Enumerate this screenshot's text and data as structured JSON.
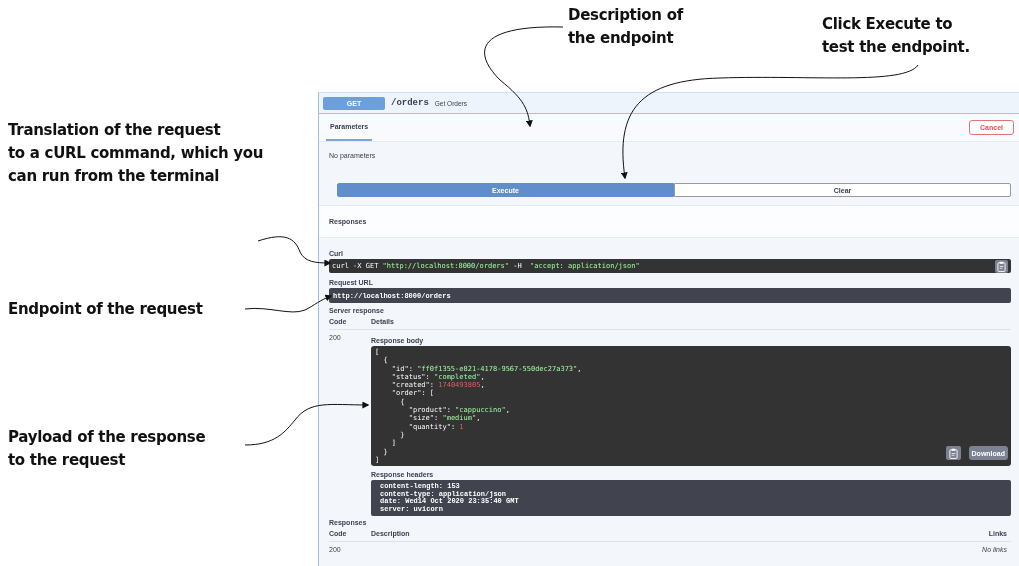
{
  "callouts": [
    {
      "kind": "top-left",
      "text": "Description of\nthe endpoint"
    },
    {
      "kind": "top-right",
      "text": "Click Execute to\ntest the endpoint."
    },
    {
      "kind": "curl",
      "text": "Translation of the request\nto a cURL command, which you\ncan run from the terminal"
    },
    {
      "kind": "url",
      "text": "Endpoint of the request"
    },
    {
      "kind": "payload",
      "text": "Payload of the response\nto the request"
    }
  ],
  "operation": {
    "method": "GET",
    "path": "/orders",
    "summary": "Get Orders"
  },
  "tabs": [
    {
      "label": "Parameters",
      "selected": true
    }
  ],
  "cancel": "Cancel",
  "parameters_note": "No parameters",
  "actions": [
    {
      "label": "Execute",
      "kind": "primary"
    },
    {
      "label": "Clear",
      "kind": "secondary"
    }
  ],
  "responses_title": "Responses",
  "curl": {
    "label": "Curl",
    "command": "curl -X GET \"http://localhost:8000/orders\" -H  \"accept: application/json\""
  },
  "request_url": {
    "label": "Request URL",
    "value": "http://localhost:8000/orders"
  },
  "server_response": {
    "label": "Server response",
    "columns": [
      "Code",
      "Details"
    ],
    "code": "200",
    "body_label": "Response body",
    "body": "[\n  {\n    \"id\": \"ff0f1355-e821-4178-9567-550dec27a373\",\n    \"status\": \"completed\",\n    \"created\": 1740493805,\n    \"order\": [\n      {\n        \"product\": \"cappuccino\",\n        \"size\": \"medium\",\n        \"quantity\": 1\n      }\n    ]\n  }\n]",
    "download": "Download",
    "headers_label": "Response headers",
    "headers": "content-length: 153\ncontent-type: application/json\ndate: Wed14 Oct 2020 23:35:40 GMT\nserver: uvicorn"
  },
  "responses": {
    "label": "Responses",
    "columns": [
      "Code",
      "Description",
      "Links"
    ],
    "rows": [
      {
        "code": "200",
        "links": "No links"
      }
    ]
  }
}
